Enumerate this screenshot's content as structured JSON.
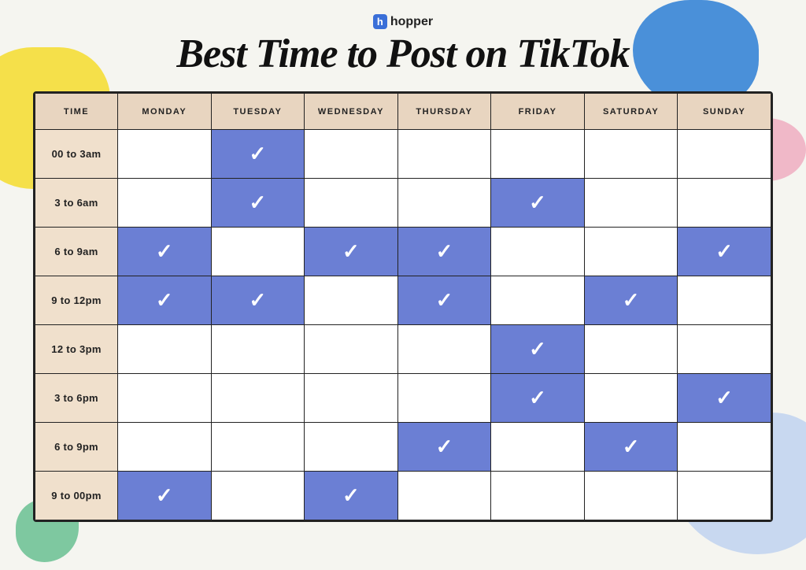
{
  "logo": {
    "icon": "h",
    "name": "hopper"
  },
  "title": "Best Time to Post on TikTok",
  "table": {
    "headers": [
      "TIME",
      "MONDAY",
      "TUESDAY",
      "WEDNESDAY",
      "THURSDAY",
      "FRIDAY",
      "SATURDAY",
      "SUNDAY"
    ],
    "rows": [
      {
        "time": "00 to 3am",
        "cells": [
          false,
          true,
          false,
          false,
          false,
          false,
          false
        ]
      },
      {
        "time": "3 to 6am",
        "cells": [
          false,
          true,
          false,
          false,
          true,
          false,
          false
        ]
      },
      {
        "time": "6 to 9am",
        "cells": [
          true,
          false,
          true,
          true,
          false,
          false,
          true
        ]
      },
      {
        "time": "9 to 12pm",
        "cells": [
          true,
          true,
          false,
          true,
          false,
          true,
          false
        ]
      },
      {
        "time": "12 to 3pm",
        "cells": [
          false,
          false,
          false,
          false,
          true,
          false,
          false
        ]
      },
      {
        "time": "3 to 6pm",
        "cells": [
          false,
          false,
          false,
          false,
          true,
          false,
          true
        ]
      },
      {
        "time": "6 to 9pm",
        "cells": [
          false,
          false,
          false,
          true,
          false,
          true,
          false
        ]
      },
      {
        "time": "9 to 00pm",
        "cells": [
          true,
          false,
          true,
          false,
          false,
          false,
          false
        ]
      }
    ]
  }
}
